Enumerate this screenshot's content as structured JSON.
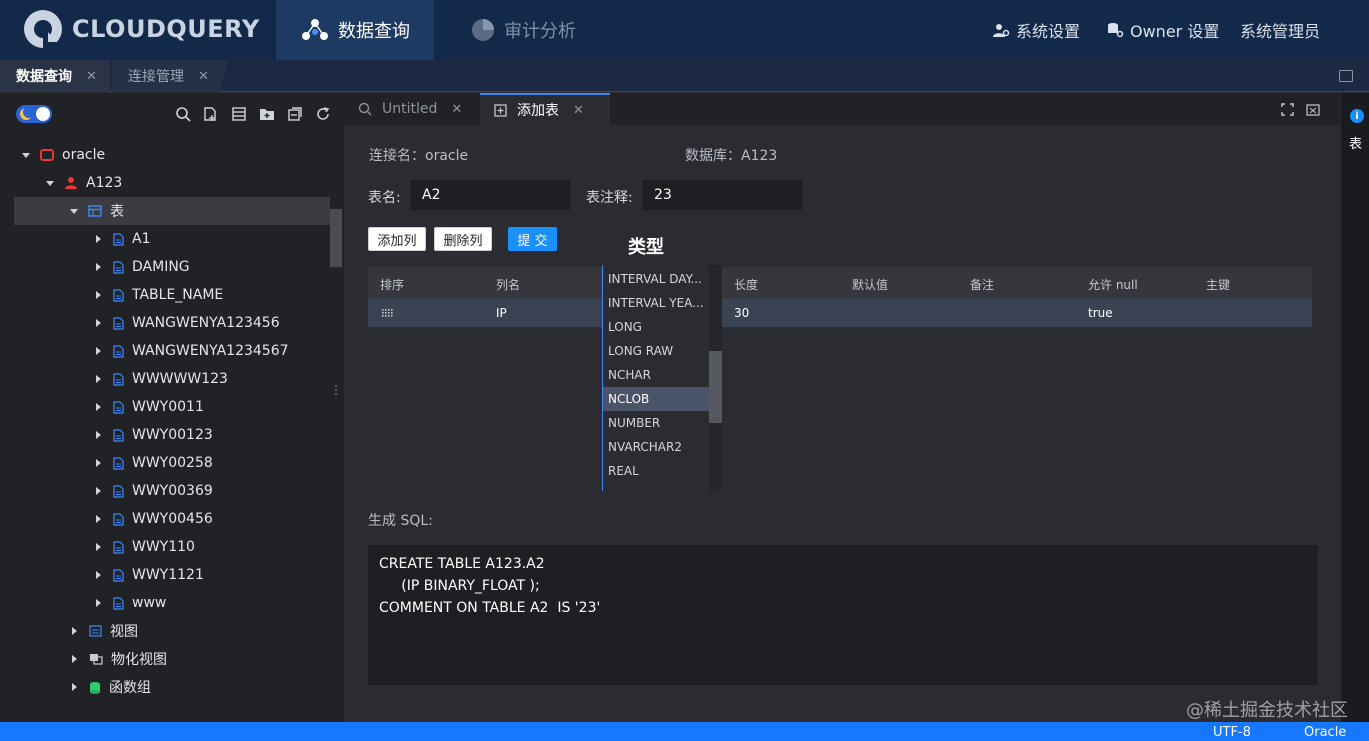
{
  "header": {
    "logo_text": "CLOUDQUERY",
    "nav": [
      {
        "label": "数据查询",
        "active": true
      },
      {
        "label": "审计分析",
        "active": false
      }
    ],
    "right": {
      "settings": "系统设置",
      "owner_settings": "Owner 设置",
      "admin": "系统管理员"
    }
  },
  "app_tabs": [
    {
      "label": "数据查询",
      "active": true
    },
    {
      "label": "连接管理",
      "active": false
    }
  ],
  "sidebar": {
    "tree": {
      "connection": "oracle",
      "schema": "A123",
      "table_group": "表",
      "tables": [
        "A1",
        "DAMING",
        "TABLE_NAME",
        "WANGWENYA123456",
        "WANGWENYA1234567",
        "WWWWW123",
        "WWY0011",
        "WWY00123",
        "WWY00258",
        "WWY00369",
        "WWY00456",
        "WWY110",
        "WWY1121",
        "www"
      ],
      "groups": [
        "视图",
        "物化视图",
        "函数组"
      ]
    }
  },
  "editor_tabs": [
    {
      "label": "Untitled",
      "active": false
    },
    {
      "label": "添加表",
      "active": true
    }
  ],
  "form": {
    "connection_label": "连接名：oracle",
    "database_label": "数据库：A123",
    "table_name_label": "表名:",
    "table_name_value": "A2",
    "table_comment_label": "表注释:",
    "table_comment_value": "23",
    "buttons": {
      "add_column": "添加列",
      "delete_column": "删除列",
      "submit": "提 交"
    }
  },
  "type_popover_title": "类型",
  "grid": {
    "headers": [
      "排序",
      "列名",
      "长度",
      "默认值",
      "备注",
      "允许 null",
      "主键"
    ],
    "rows": [
      {
        "column_name": "IP",
        "length": "30",
        "nullable": "true"
      }
    ]
  },
  "type_dropdown": {
    "options": [
      "INTERVAL DAY...",
      "INTERVAL YEA...",
      "LONG",
      "LONG RAW",
      "NCHAR",
      "NCLOB",
      "NUMBER",
      "NVARCHAR2",
      "REAL"
    ],
    "highlighted": "NCLOB"
  },
  "sql": {
    "label": "生成 SQL:",
    "text": "CREATE TABLE A123.A2\n     (IP BINARY_FLOAT );\nCOMMENT ON TABLE A2  IS '23'"
  },
  "right_rail": {
    "label": "表"
  },
  "status": {
    "encoding": "UTF-8",
    "db_type": "Oracle"
  },
  "watermark": "@稀土掘金技术社区",
  "colors": {
    "header_bg": "#13294a",
    "accent": "#1890ff",
    "status_bar": "#1677ff"
  }
}
